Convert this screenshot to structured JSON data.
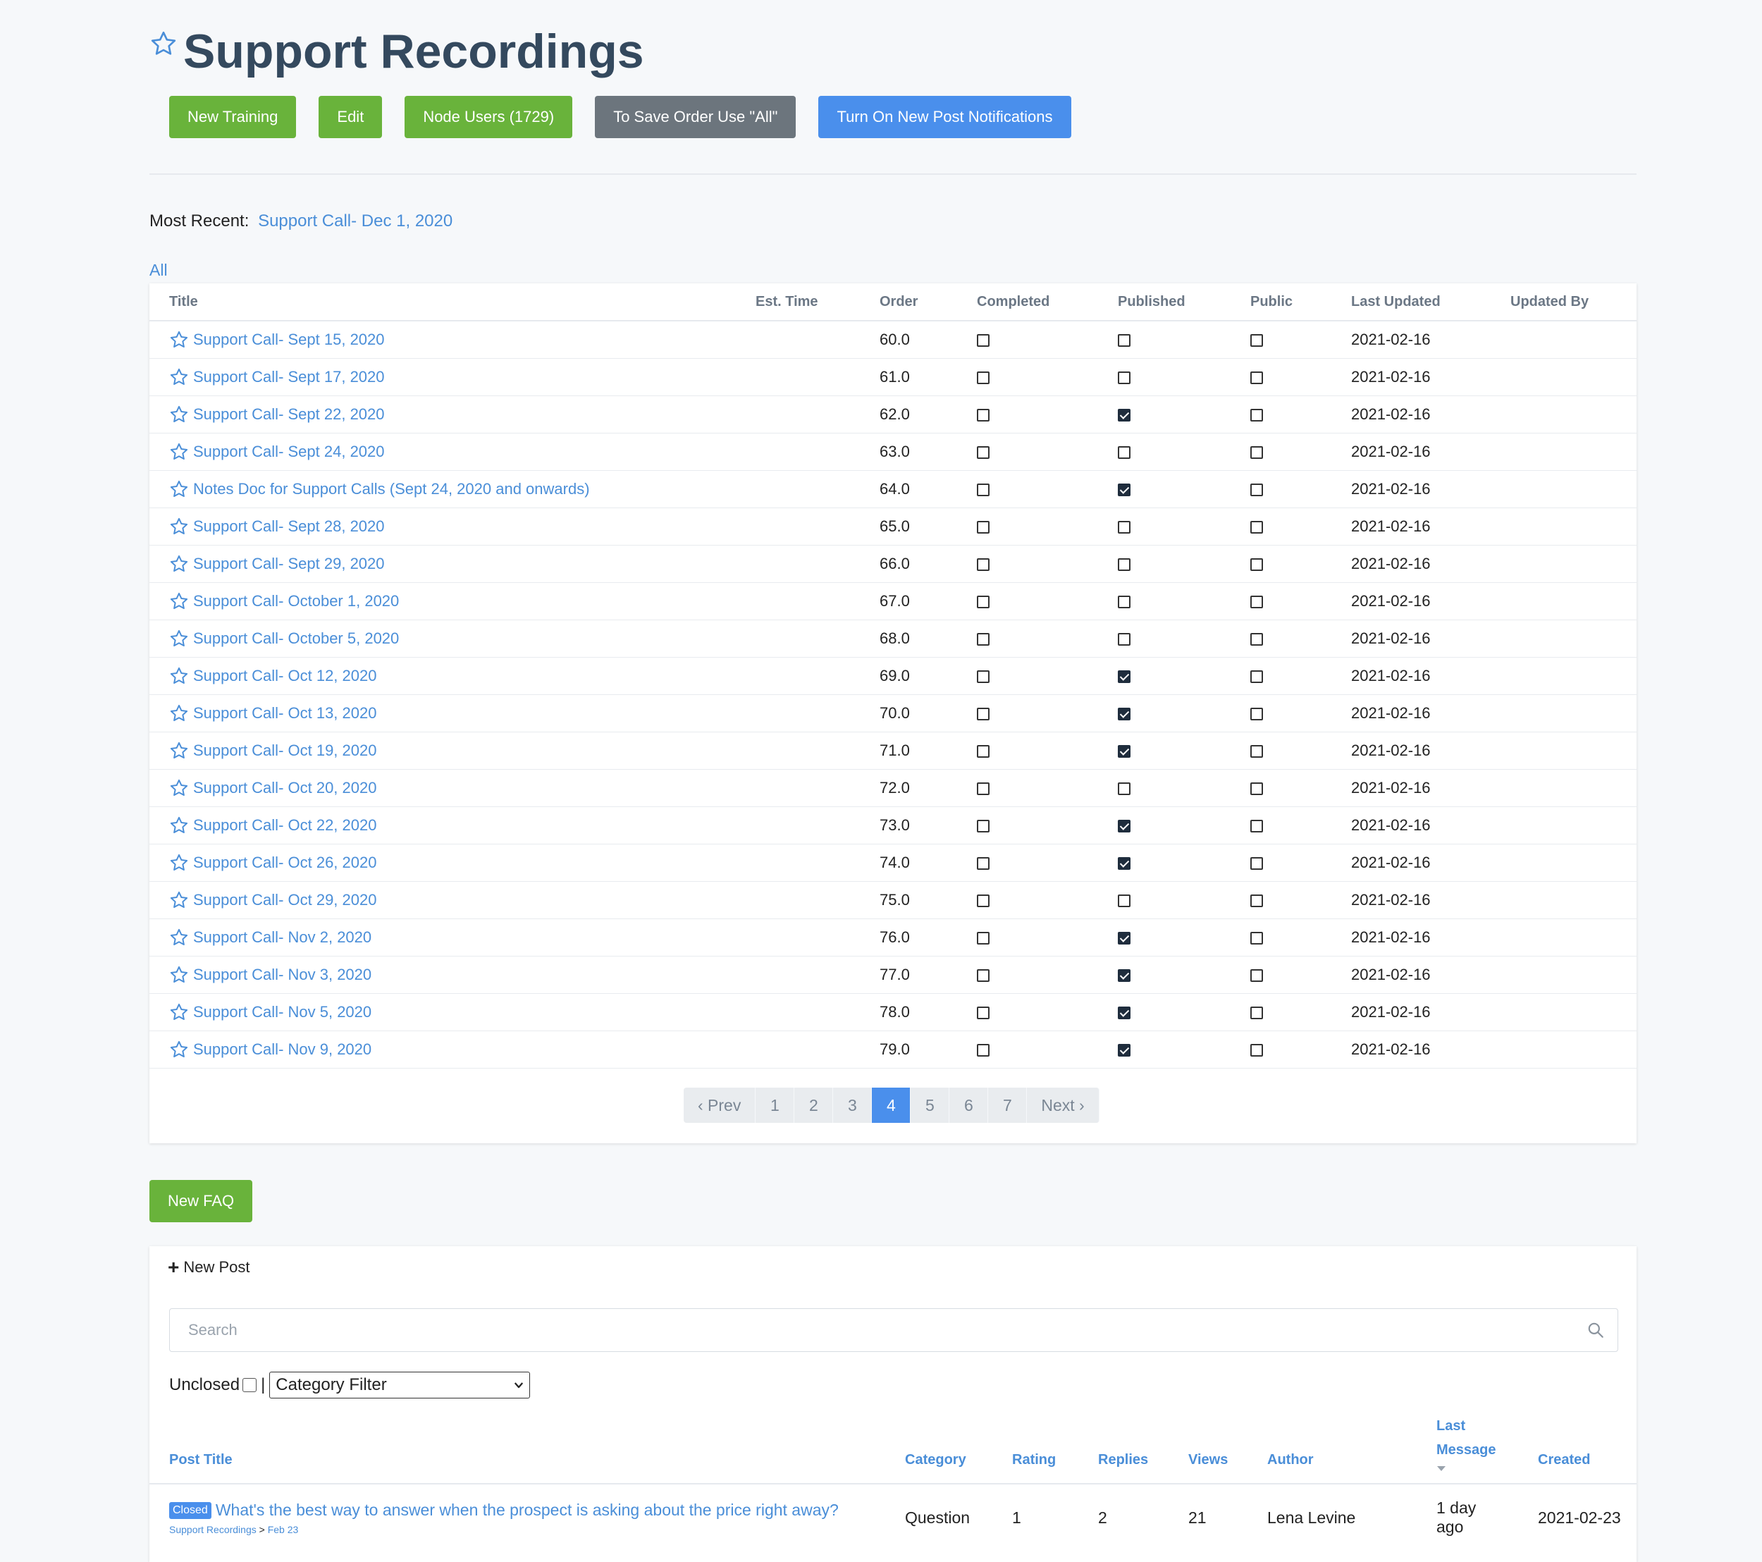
{
  "page": {
    "title": "Support Recordings"
  },
  "toolbar": {
    "new_training": "New Training",
    "edit": "Edit",
    "node_users": "Node Users (1729)",
    "save_order": "To Save Order Use \"All\"",
    "notifications": "Turn On New Post Notifications"
  },
  "most_recent": {
    "label": "Most Recent:",
    "link": "Support Call- Dec 1, 2020"
  },
  "filter_all": "All",
  "trainings": {
    "columns": [
      "Title",
      "Est. Time",
      "Order",
      "Completed",
      "Published",
      "Public",
      "Last Updated",
      "Updated By"
    ],
    "rows": [
      {
        "title": "Support Call- Sept 15, 2020",
        "order": "60.0",
        "completed": false,
        "published": false,
        "public": false,
        "updated": "2021-02-16"
      },
      {
        "title": "Support Call- Sept 17, 2020",
        "order": "61.0",
        "completed": false,
        "published": false,
        "public": false,
        "updated": "2021-02-16"
      },
      {
        "title": "Support Call- Sept 22, 2020",
        "order": "62.0",
        "completed": false,
        "published": true,
        "public": false,
        "updated": "2021-02-16"
      },
      {
        "title": "Support Call- Sept 24, 2020",
        "order": "63.0",
        "completed": false,
        "published": false,
        "public": false,
        "updated": "2021-02-16"
      },
      {
        "title": "Notes Doc for Support Calls (Sept 24, 2020 and onwards)",
        "order": "64.0",
        "completed": false,
        "published": true,
        "public": false,
        "updated": "2021-02-16"
      },
      {
        "title": "Support Call- Sept 28, 2020",
        "order": "65.0",
        "completed": false,
        "published": false,
        "public": false,
        "updated": "2021-02-16"
      },
      {
        "title": "Support Call- Sept 29, 2020",
        "order": "66.0",
        "completed": false,
        "published": false,
        "public": false,
        "updated": "2021-02-16"
      },
      {
        "title": "Support Call- October 1, 2020",
        "order": "67.0",
        "completed": false,
        "published": false,
        "public": false,
        "updated": "2021-02-16"
      },
      {
        "title": "Support Call- October 5, 2020",
        "order": "68.0",
        "completed": false,
        "published": false,
        "public": false,
        "updated": "2021-02-16"
      },
      {
        "title": "Support Call- Oct 12, 2020",
        "order": "69.0",
        "completed": false,
        "published": true,
        "public": false,
        "updated": "2021-02-16"
      },
      {
        "title": "Support Call- Oct 13, 2020",
        "order": "70.0",
        "completed": false,
        "published": true,
        "public": false,
        "updated": "2021-02-16"
      },
      {
        "title": "Support Call- Oct 19, 2020",
        "order": "71.0",
        "completed": false,
        "published": true,
        "public": false,
        "updated": "2021-02-16"
      },
      {
        "title": "Support Call- Oct 20, 2020",
        "order": "72.0",
        "completed": false,
        "published": false,
        "public": false,
        "updated": "2021-02-16"
      },
      {
        "title": "Support Call- Oct 22, 2020",
        "order": "73.0",
        "completed": false,
        "published": true,
        "public": false,
        "updated": "2021-02-16"
      },
      {
        "title": "Support Call- Oct 26, 2020",
        "order": "74.0",
        "completed": false,
        "published": true,
        "public": false,
        "updated": "2021-02-16"
      },
      {
        "title": "Support Call- Oct 29, 2020",
        "order": "75.0",
        "completed": false,
        "published": false,
        "public": false,
        "updated": "2021-02-16"
      },
      {
        "title": "Support Call- Nov 2, 2020",
        "order": "76.0",
        "completed": false,
        "published": true,
        "public": false,
        "updated": "2021-02-16"
      },
      {
        "title": "Support Call- Nov 3, 2020",
        "order": "77.0",
        "completed": false,
        "published": true,
        "public": false,
        "updated": "2021-02-16"
      },
      {
        "title": "Support Call- Nov 5, 2020",
        "order": "78.0",
        "completed": false,
        "published": true,
        "public": false,
        "updated": "2021-02-16"
      },
      {
        "title": "Support Call- Nov 9, 2020",
        "order": "79.0",
        "completed": false,
        "published": true,
        "public": false,
        "updated": "2021-02-16"
      }
    ]
  },
  "pagination": {
    "prev": "‹ Prev",
    "next": "Next ›",
    "pages": [
      "1",
      "2",
      "3",
      "4",
      "5",
      "6",
      "7"
    ],
    "active": "4"
  },
  "faq": {
    "new_faq": "New FAQ",
    "new_post": "New Post",
    "search_placeholder": "Search",
    "unclosed_label": "Unclosed",
    "separator": "|",
    "category_filter": "Category Filter",
    "columns": {
      "title": "Post Title",
      "category": "Category",
      "rating": "Rating",
      "replies": "Replies",
      "views": "Views",
      "author": "Author",
      "last_message_1": "Last",
      "last_message_2": "Message",
      "created": "Created"
    },
    "posts": [
      {
        "badge": "Closed",
        "title": "What's the best way to answer when the prospect is asking about the price right away?",
        "crumb_node": "Support Recordings",
        "crumb_sep": ">",
        "crumb_date": "Feb 23",
        "category": "Question",
        "rating": "1",
        "replies": "2",
        "views": "21",
        "author": "Lena Levine",
        "last_message_1": "1 day",
        "last_message_2": "ago",
        "created": "2021-02-23"
      }
    ]
  },
  "colors": {
    "green": "#69b33b",
    "gray": "#6c757d",
    "blue": "#4a8fec",
    "link": "#4a8ed8",
    "title": "#34495e"
  }
}
